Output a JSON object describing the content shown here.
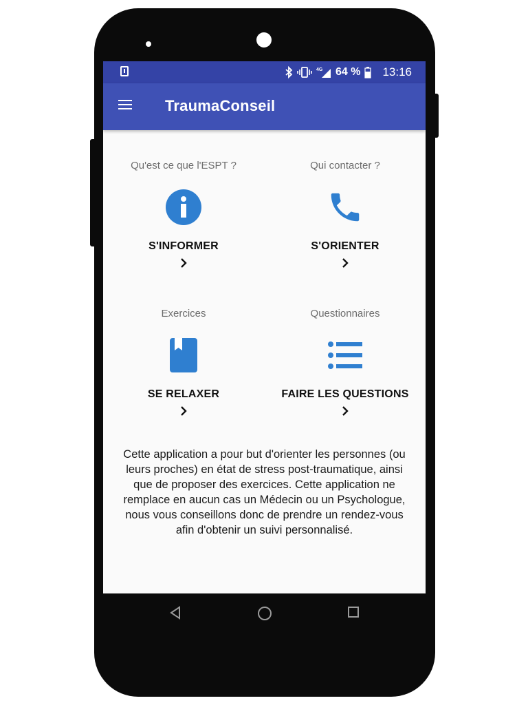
{
  "status_bar": {
    "network": "4G",
    "battery": "64 %",
    "time": "13:16"
  },
  "app_bar": {
    "title": "TraumaConseil",
    "menu_icon": "hamburger-menu-icon"
  },
  "tiles": [
    {
      "caption": "Qu'est ce que l'ESPT ?",
      "label": "S'INFORMER",
      "icon": "info-icon"
    },
    {
      "caption": "Qui contacter ?",
      "label": "S'ORIENTER",
      "icon": "phone-icon"
    },
    {
      "caption": "Exercices",
      "label": "SE RELAXER",
      "icon": "book-icon"
    },
    {
      "caption": "Questionnaires",
      "label": "FAIRE LES QUESTIONS",
      "icon": "list-icon"
    }
  ],
  "description": "Cette application a pour but d'orienter les personnes (ou leurs proches) en état de stress post-traumatique, ainsi que de proposer des exercices. Cette application ne remplace en aucun cas un Médecin ou un Psychologue, nous vous conseillons donc de prendre un rendez-vous afin d'obtenir un suivi personnalisé.",
  "nav_bar": {
    "back_icon": "back-triangle-icon",
    "home_icon": "home-circle-icon",
    "recents_icon": "recents-square-icon"
  },
  "colors": {
    "status_bar": "#3443a6",
    "app_bar": "#3f51b5",
    "icon_blue": "#2f7fd0",
    "screen_bg": "#fafafa",
    "phone_body": "#0b0b0b"
  }
}
